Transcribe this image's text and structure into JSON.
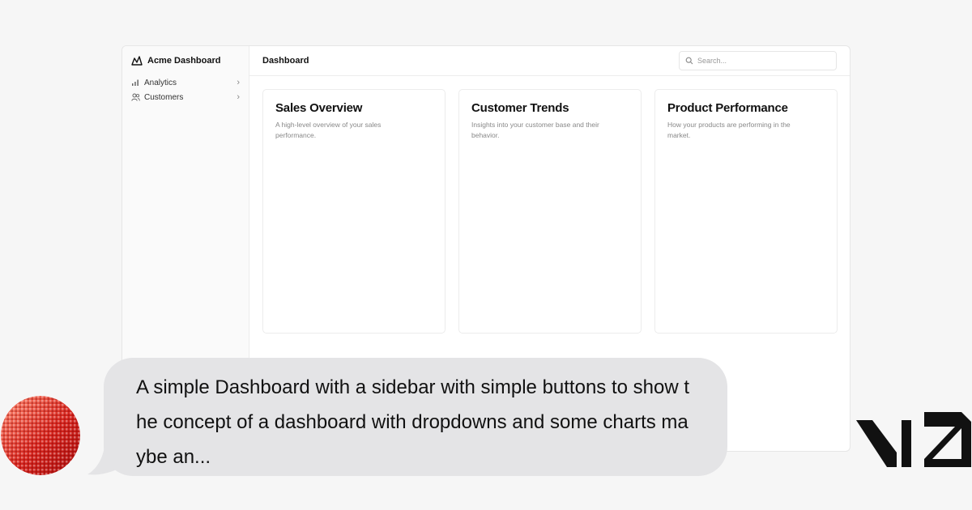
{
  "app": {
    "brand_name": "Acme Dashboard"
  },
  "sidebar": {
    "items": [
      {
        "label": "Analytics",
        "icon": "bar-chart-icon"
      },
      {
        "label": "Customers",
        "icon": "users-icon"
      }
    ]
  },
  "header": {
    "title": "Dashboard",
    "search_placeholder": "Search..."
  },
  "cards": [
    {
      "title": "Sales Overview",
      "description": "A high-level overview of your sales performance."
    },
    {
      "title": "Customer Trends",
      "description": "Insights into your customer base and their behavior."
    },
    {
      "title": "Product Performance",
      "description": "How your products are performing in the market."
    }
  ],
  "chat": {
    "message": "A simple Dashboard with a sidebar with simple buttons to show the concept of a dashboard with dropdowns and some charts maybe an..."
  },
  "colors": {
    "background": "#f6f6f6",
    "bubble": "#e4e4e6",
    "avatar": "#c8201c"
  }
}
